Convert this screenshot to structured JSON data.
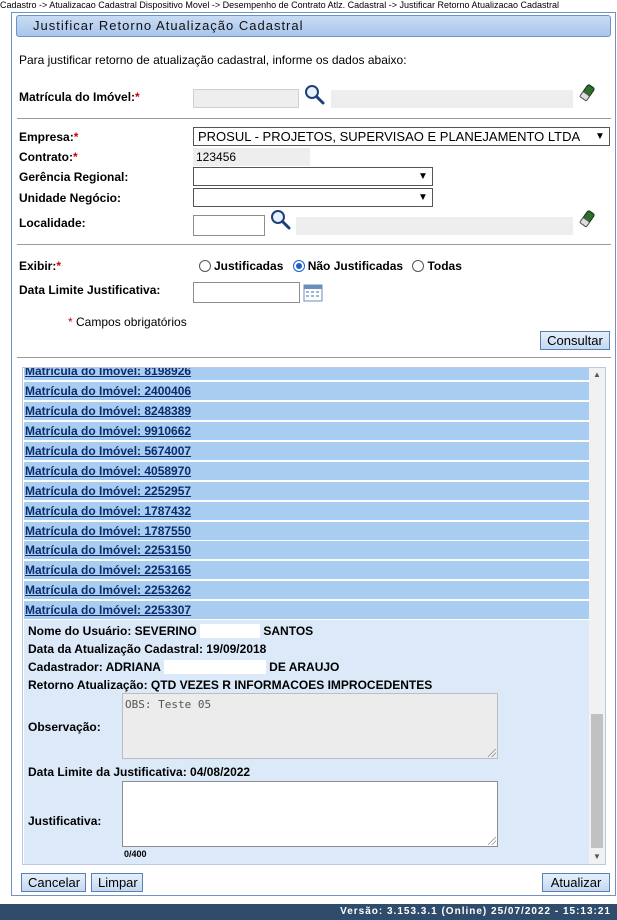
{
  "breadcrumb": "Cadastro -> Atualizacao Cadastral Dispositivo Movel -> Desempenho de Contrato Atlz. Cadastral -> Justificar Retorno Atualizacao Cadastral",
  "title": "Justificar Retorno Atualização Cadastral",
  "intro": "Para justificar retorno de atualização cadastral, informe os dados abaixo:",
  "required_mark": "*",
  "filters": {
    "matricula_label": "Matrícula do Imóvel:",
    "empresa_label": "Empresa:",
    "empresa_value": "PROSUL - PROJETOS, SUPERVISAO E PLANEJAMENTO LTDA",
    "contrato_label": "Contrato:",
    "contrato_value": "123456",
    "gerencia_label": "Gerência Regional:",
    "unidade_label": "Unidade Negócio:",
    "localidade_label": "Localidade:",
    "exibir_label": "Exibir:",
    "exibir_options": [
      "Justificadas",
      "Não Justificadas",
      "Todas"
    ],
    "exibir_selected": "Não Justificadas",
    "data_limite_label": "Data Limite Justificativa:",
    "required_note": "Campos obrigatórios",
    "consultar_button": "Consultar"
  },
  "results": [
    "Matrícula do Imóvel: 8198926",
    "Matrícula do Imóvel: 2400406",
    "Matrícula do Imóvel: 8248389",
    "Matrícula do Imóvel: 9910662",
    "Matrícula do Imóvel: 5674007",
    "Matrícula do Imóvel: 4058970",
    "Matrícula do Imóvel: 2252957",
    "Matrícula do Imóvel: 1787432",
    "Matrícula do Imóvel: 1787550",
    "Matrícula do Imóvel: 2253150",
    "Matrícula do Imóvel: 2253165",
    "Matrícula do Imóvel: 2253262",
    "Matrícula do Imóvel: 2253307"
  ],
  "detail": {
    "usuario_prefix": "Nome do Usuário: SEVERINO",
    "usuario_suffix": "SANTOS",
    "data_atualizacao": "Data da Atualização Cadastral: 19/09/2018",
    "cadastrador_prefix": "Cadastrador: ADRIANA",
    "cadastrador_suffix": "DE ARAUJO",
    "retorno": "Retorno Atualização: QTD VEZES R INFORMACOES IMPROCEDENTES",
    "observacao_label": "Observação:",
    "observacao_value": "OBS: Teste 05",
    "data_limite": "Data Limite da Justificativa: 04/08/2022",
    "justificativa_label": "Justificativa:",
    "char_count": "0/400"
  },
  "buttons": {
    "cancelar": "Cancelar",
    "limpar": "Limpar",
    "atualizar": "Atualizar"
  },
  "version": "Versão: 3.153.3.1 (Online) 25/07/2022 - 15:13:21"
}
